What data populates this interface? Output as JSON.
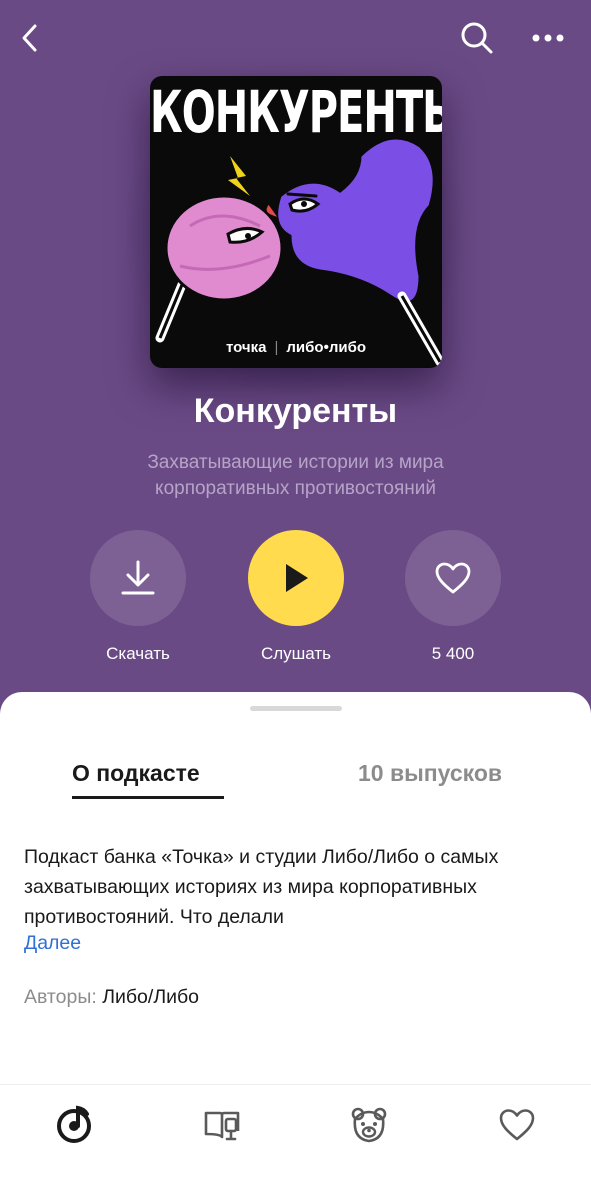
{
  "topbar": {
    "back_icon": "chevron-left-icon",
    "search_icon": "search-icon",
    "more_icon": "more-dots-icon"
  },
  "cover": {
    "title": "КОНКУРЕНТЫ",
    "brand_left": "точка",
    "brand_separator": "|",
    "brand_right": "либо•либо"
  },
  "podcast": {
    "title": "Конкуренты",
    "subtitle": "Захватывающие истории из мира корпоративных противостояний"
  },
  "actions": {
    "download_label": "Скачать",
    "listen_label": "Слушать",
    "likes_count": "5 400"
  },
  "tabs": {
    "about": "О подкасте",
    "episodes": "10 выпусков"
  },
  "about": {
    "description": "Подкаст банка «Точка» и студии Либо/Либо о самых захватывающих историях из мира корпоративных противостояний. Что делали",
    "more_link": "Далее",
    "authors_label": "Авторы:",
    "authors_value": "Либо/Либо"
  },
  "bottom_nav": {
    "icons": [
      "music-wave-icon",
      "books-icon",
      "kids-bear-icon",
      "heart-icon"
    ]
  },
  "colors": {
    "hero_bg": "#6a4a85",
    "play_button": "#ffdb4d",
    "link": "#2f6fd6"
  }
}
